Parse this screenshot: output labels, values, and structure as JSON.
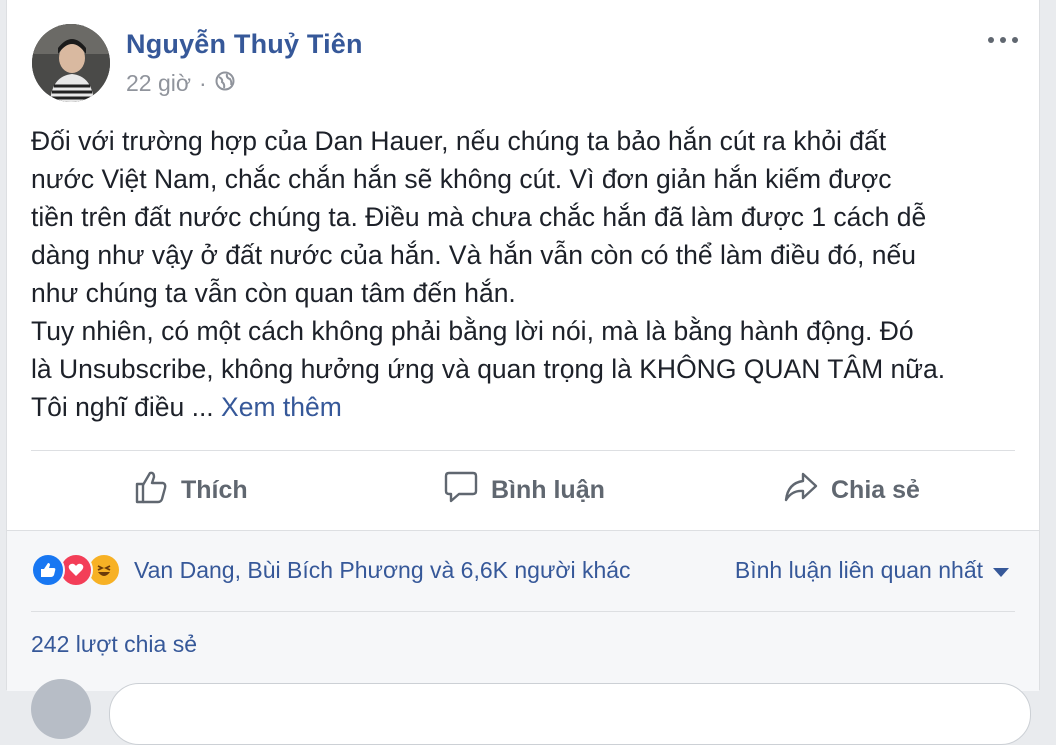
{
  "author": {
    "name": "Nguyễn Thuỷ Tiên"
  },
  "meta": {
    "time": "22 giờ",
    "separator": "·",
    "privacy_icon": "globe-icon"
  },
  "post": {
    "lines": [
      "Đối với trường hợp của Dan Hauer, nếu chúng ta bảo hắn cút ra khỏi đất",
      "nước Việt Nam, chắc chắn hắn sẽ không cút. Vì đơn giản hắn kiếm được",
      "tiền trên đất nước chúng ta. Điều mà chưa chắc hắn đã làm được 1 cách dễ",
      "dàng như vậy ở đất nước của hắn. Và hắn vẫn còn có thể làm điều đó, nếu",
      "như chúng ta vẫn còn quan tâm đến hắn.",
      "Tuy nhiên, có một cách không phải bằng lời nói, mà là bằng hành động. Đó",
      "là Unsubscribe, không hưởng ứng và quan trọng là KHÔNG QUAN TÂM nữa."
    ],
    "last_line": "Tôi nghĩ điều ...",
    "see_more": "Xem thêm"
  },
  "actions": {
    "like": "Thích",
    "comment": "Bình luận",
    "share": "Chia sẻ"
  },
  "reactions": {
    "icons": [
      "like-icon",
      "love-icon",
      "haha-icon"
    ],
    "summary": "Van Dang, Bùi Bích Phương và 6,6K người khác"
  },
  "sort": {
    "label": "Bình luận liên quan nhất"
  },
  "shares": {
    "label": "242 lượt chia sẻ"
  },
  "colors": {
    "link": "#365899",
    "like": "#1877f2",
    "love": "#f33e58",
    "haha": "#f7b125"
  }
}
